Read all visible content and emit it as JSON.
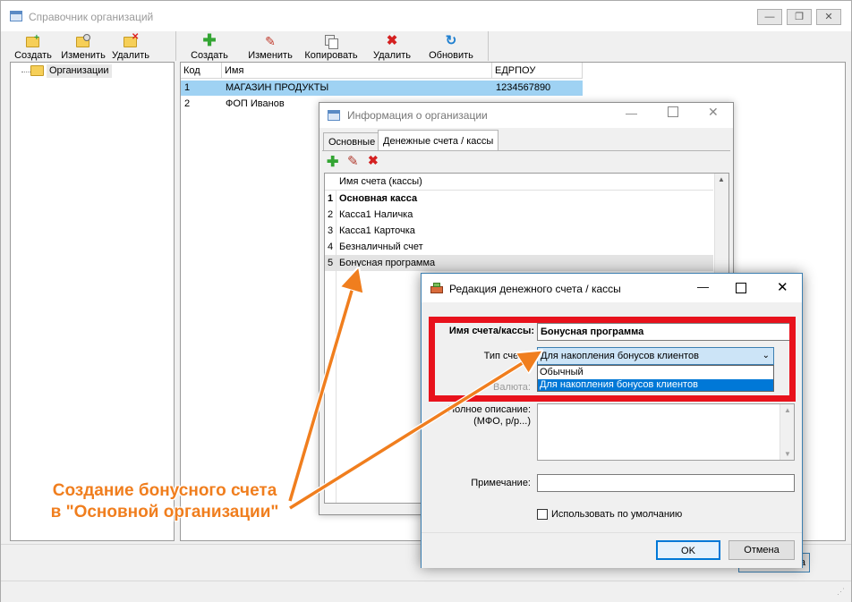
{
  "main_window": {
    "title": "Справочник организаций",
    "controls": {
      "minimize": "—",
      "restore": "❐",
      "close": "✕"
    },
    "tree_toolbar": [
      {
        "label": "Создать",
        "icon": "folder-add-icon"
      },
      {
        "label": "Изменить",
        "icon": "folder-edit-icon"
      },
      {
        "label": "Удалить",
        "icon": "folder-delete-icon"
      }
    ],
    "grid_toolbar": [
      {
        "label": "Создать",
        "icon": "plus-icon"
      },
      {
        "label": "Изменить",
        "icon": "pencil-icon"
      },
      {
        "label": "Копировать",
        "icon": "copy-icon"
      },
      {
        "label": "Удалить",
        "icon": "delete-x-icon"
      },
      {
        "label": "Обновить",
        "icon": "refresh-icon"
      }
    ],
    "tree": {
      "root": "Организации"
    },
    "grid": {
      "columns": [
        "Код",
        "Имя",
        "ЕДРПОУ"
      ],
      "rows": [
        {
          "code": "1",
          "name": "МАГАЗИН ПРОДУКТЫ",
          "edrpou": "1234567890"
        },
        {
          "code": "2",
          "name": "ФОП Иванов",
          "edrpou": ""
        }
      ]
    },
    "bottom_button_fragment": "а"
  },
  "info_dialog": {
    "title": "Информация о организации",
    "tabs": [
      "Основные",
      "Денежные счета / кассы"
    ],
    "active_tab": 1,
    "list_header": "Имя счета (кассы)",
    "rows": [
      {
        "num": "1",
        "name": "Основная касса",
        "bold": true
      },
      {
        "num": "2",
        "name": "Касса1 Наличка"
      },
      {
        "num": "3",
        "name": "Касса1 Карточка"
      },
      {
        "num": "4",
        "name": "Безналичный счет"
      },
      {
        "num": "5",
        "name": "Бонусная программа",
        "selected": true
      }
    ]
  },
  "edit_dialog": {
    "title": "Редакция денежного счета / кассы",
    "name_label": "Имя счета/кассы:",
    "name_value": "Бонусная программа",
    "type_label": "Тип счета:",
    "type_value": "Для накопления бонусов клиентов",
    "type_options": [
      "Обычный",
      "Для накопления бонусов клиентов"
    ],
    "currency_label": "Валюта:",
    "description_label_1": "Полное описание:",
    "description_label_2": "(МФО, р/р...)",
    "note_label": "Примечание:",
    "default_checkbox_label": "Использовать по умолчанию",
    "ok_label": "OK",
    "cancel_label": "Отмена"
  },
  "annotation": {
    "line1": "Создание бонусного счета",
    "line2": "в \"Основной организации\"",
    "color": "#f07e1e",
    "highlight_color": "#e8121c"
  }
}
